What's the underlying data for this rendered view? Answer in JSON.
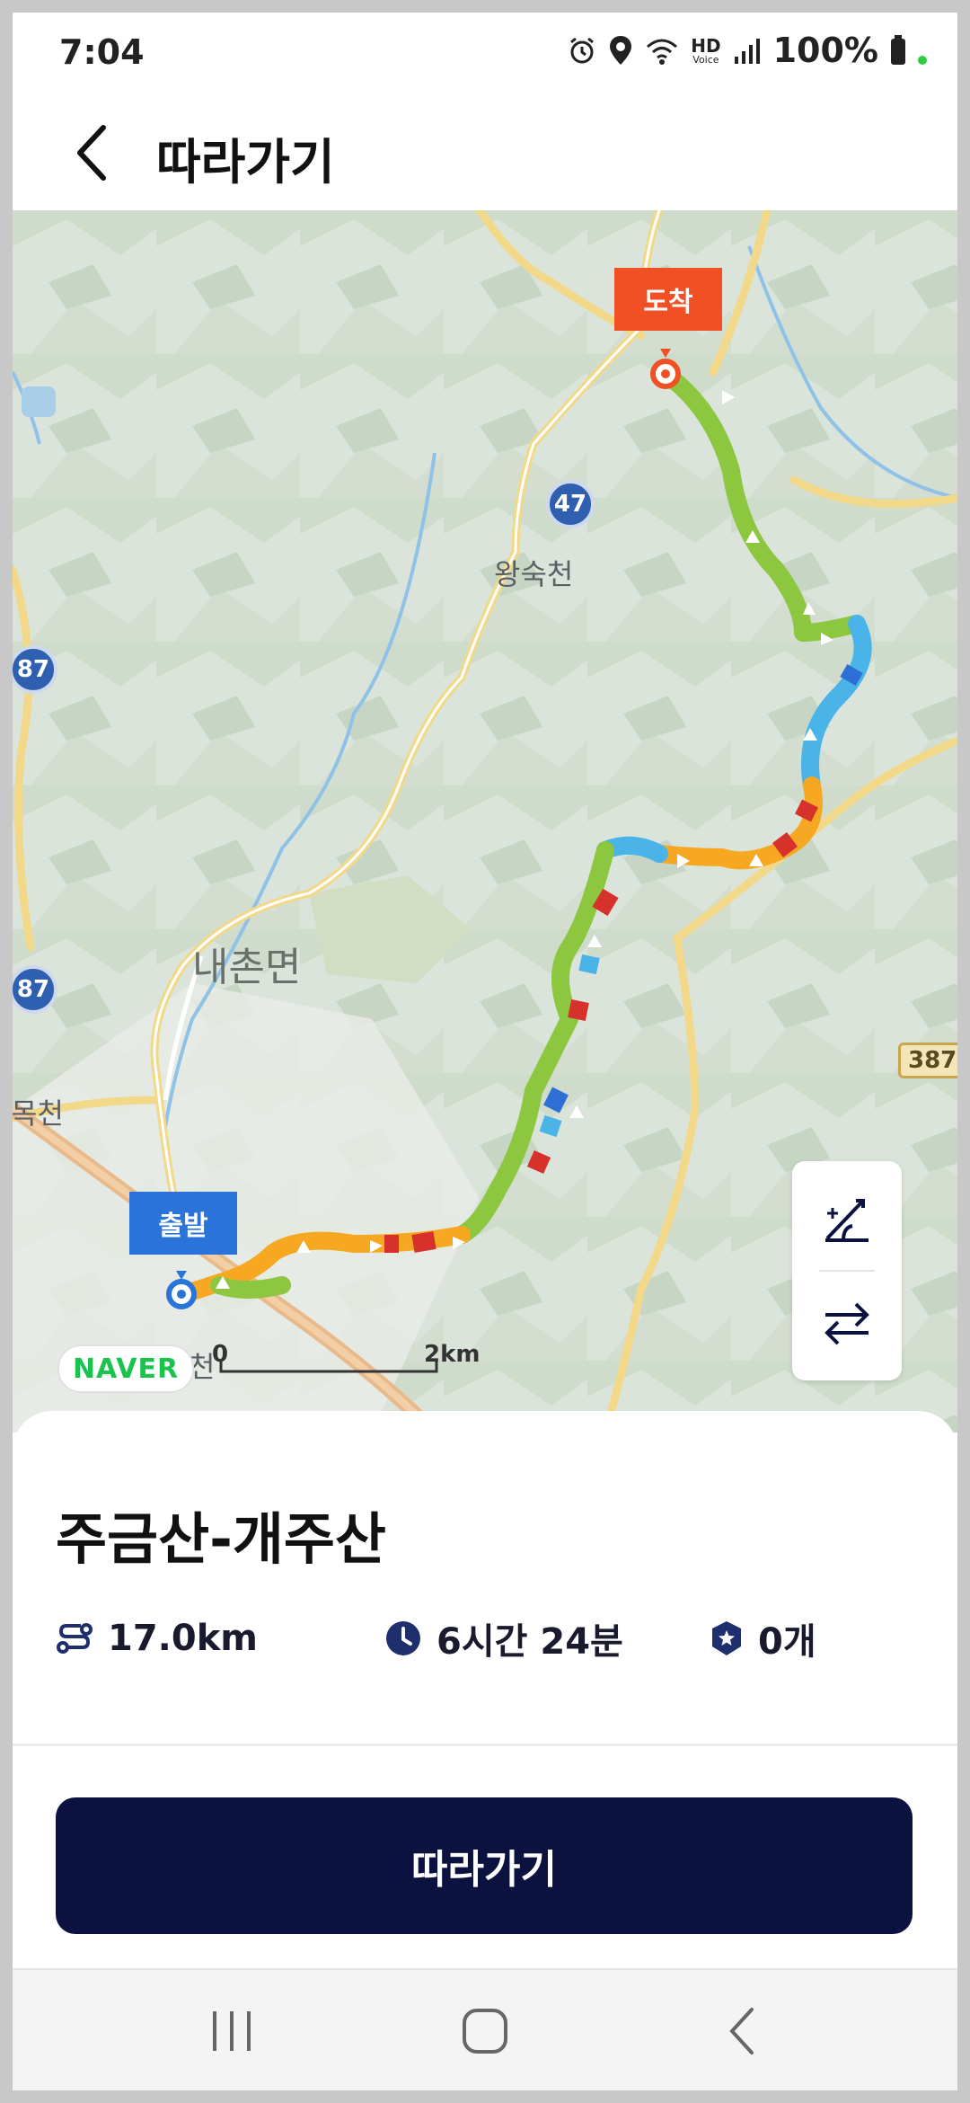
{
  "status_bar": {
    "time": "7:04",
    "battery": "100%",
    "icons": [
      "alarm-icon",
      "location-icon",
      "wifi-icon",
      "hd-voice-icon",
      "signal-icon",
      "battery-icon"
    ],
    "hd_label": "HD",
    "voice_label": "Voice"
  },
  "header": {
    "title": "따라가기",
    "back_icon": "chevron-left-icon"
  },
  "map": {
    "town_label": "내촌면",
    "place_labels": [
      "왕숙천",
      "목천",
      "천"
    ],
    "route_numbers": [
      "47",
      "87",
      "87"
    ],
    "road_sign": "387",
    "start_label": "출발",
    "end_label": "도착",
    "provider": "NAVER",
    "scale_start": "0",
    "scale_end": "2km",
    "controls": [
      "slope-icon",
      "reverse-icon"
    ],
    "colors": {
      "start": "#2a74d9",
      "end": "#f05023",
      "route_green": "#8dc63f",
      "route_blue": "#4ab3e8",
      "route_orange": "#f7a823",
      "route_red": "#d6312b"
    }
  },
  "course": {
    "name": "주금산-개주산",
    "distance": "17.0km",
    "duration": "6시간 24분",
    "badges": "0개",
    "icons": [
      "distance-icon",
      "clock-icon",
      "badge-icon"
    ]
  },
  "actions": {
    "follow_label": "따라가기",
    "button_color": "#0b1240"
  },
  "navbar": {
    "icons": [
      "recent-apps-icon",
      "home-icon",
      "back-icon"
    ]
  }
}
